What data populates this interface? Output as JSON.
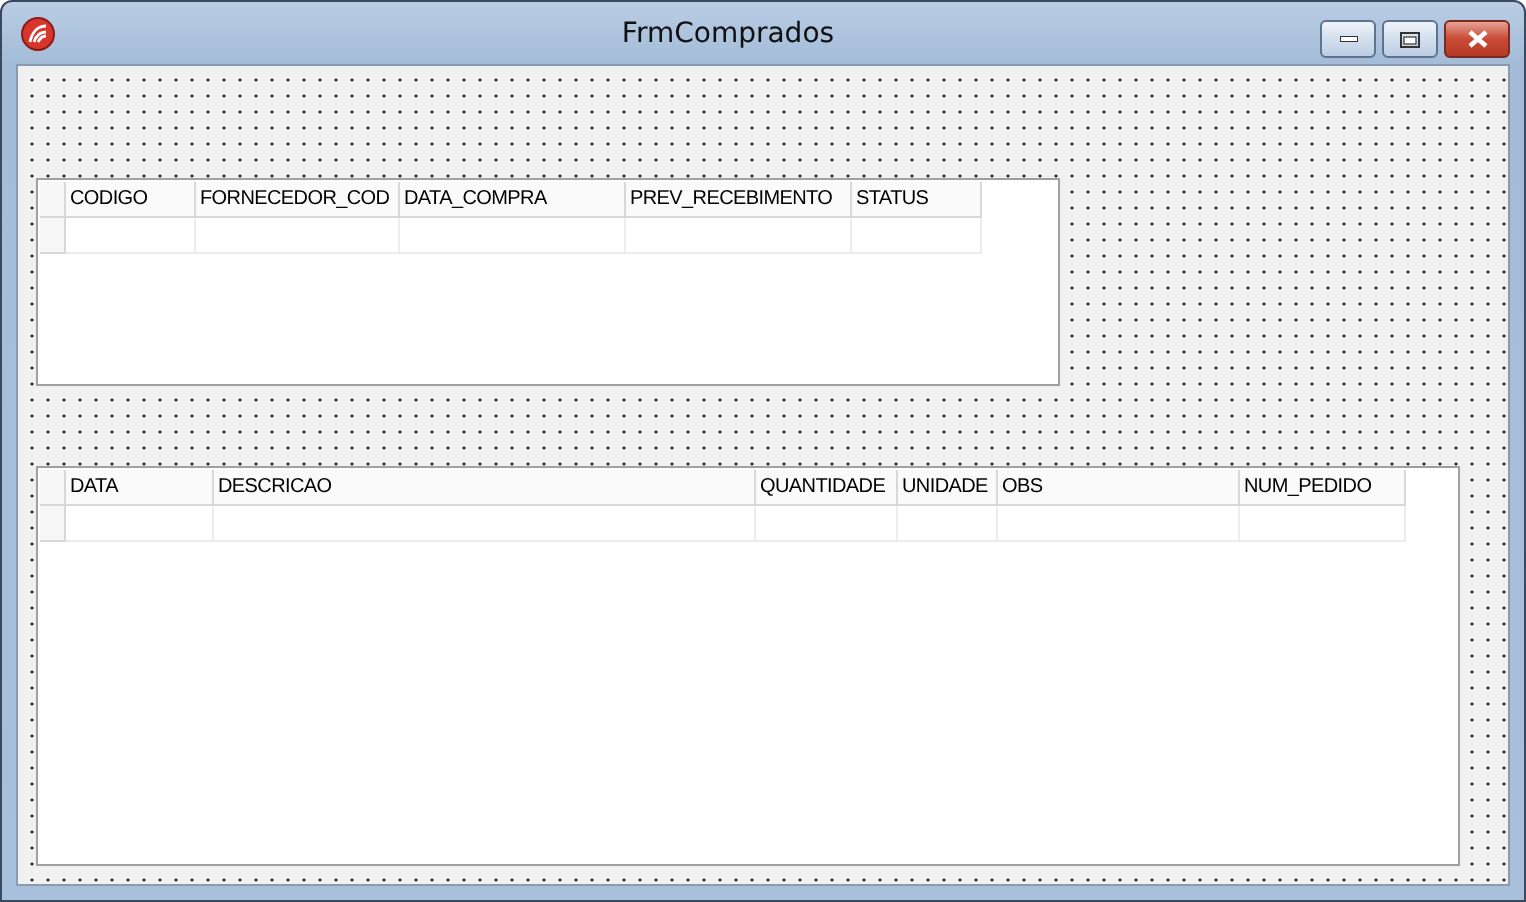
{
  "window": {
    "title": "FrmComprados"
  },
  "grids": [
    {
      "columns": [
        "CODIGO",
        "FORNECEDOR_COD",
        "DATA_COMPRA",
        "PREV_RECEBIMENTO",
        "STATUS"
      ]
    },
    {
      "columns": [
        "DATA",
        "DESCRICAO",
        "QUANTIDADE",
        "UNIDADE",
        "OBS",
        "NUM_PEDIDO"
      ]
    }
  ]
}
